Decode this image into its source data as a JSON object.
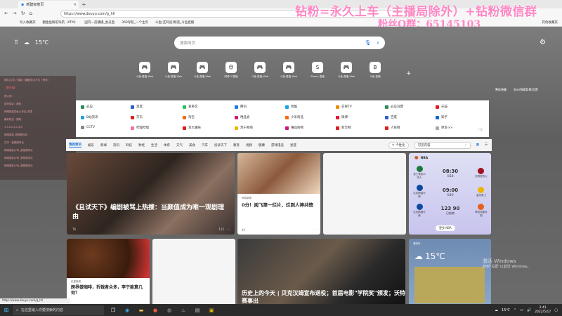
{
  "browser": {
    "tab_title": "新建标签页",
    "url": "https://www.douyu.com/g_hll",
    "favorites": [
      "导入收藏夹",
      "翻金鱼解说导航（ATM）",
      "国内一首播播_会员直",
      "360导航_一个主页",
      "斗鱼(瓦阿迪)频道_斗鱼直播"
    ],
    "favorites_right": "其他收藏夹",
    "status_url": "https://www.douyu.com/g_hll"
  },
  "overlay": {
    "line1": "钻粉=永久上车（主播局除外）+钻粉微信群",
    "line2": "粉丝Q群：65145103"
  },
  "newtab": {
    "weather_temp": "15℃",
    "search_placeholder": "搜索网页",
    "tiles": [
      {
        "label": "斗鱼-直播-Web",
        "icon": "🎮"
      },
      {
        "label": "斗鱼-直播-Web",
        "icon": "🎮"
      },
      {
        "label": "斗鱼-直播-Web",
        "icon": "🎮"
      },
      {
        "label": "网易CC直播",
        "icon": "😊"
      },
      {
        "label": "斗鱼-直播-Web",
        "icon": "🎮"
      },
      {
        "label": "斗鱼-直播-Web",
        "icon": "🎮"
      },
      {
        "label": "Steam 直播",
        "icon": "S"
      },
      {
        "label": "斗鱼-直播-Web",
        "icon": "🎮"
      },
      {
        "label": "斗鱼-直播",
        "icon": "B"
      }
    ],
    "tools": [
      "整体隐藏",
      "显示/隐藏背景/设置"
    ]
  },
  "left_panel": [
    "图片/文字 / 链接 : 隐藏/显示方式（登录）",
    "【新订阅】",
    "黑人帅 : ",
    "成分复杂 : 颜色",
    "网络朋友的女士评论_转发",
    "最好粉丝 : 随机",
    "1.3.4-2.4.2 4/0",
    "网络朋友_音视频评论",
    "文字 : 音视频评论",
    "网络朋友(V8)_音视频评论",
    "网络朋友(V8)_音视频评论",
    "网络朋友(V8)_音视频评论"
  ],
  "quick_links": [
    [
      "必应",
      "百度",
      "爱奇艺",
      "腾讯",
      "优酷",
      "芒果TV",
      "必应词典",
      "天猫"
    ],
    [
      "B站资讯",
      "京东",
      "淘宝",
      "唯品会",
      "小米商品",
      "微博",
      "百度",
      "知乎"
    ],
    [
      "CCTV",
      "哔哩哔哩",
      "双大趣味",
      "苏宁易购",
      "唯品购物",
      "新华网",
      "人民网",
      "更多>>"
    ]
  ],
  "quick_ad": "广告",
  "feed_nav": {
    "items": [
      "我的资讯",
      "娱乐",
      "新闻",
      "资讯",
      "科技",
      "财经",
      "生活",
      "体育",
      "天气",
      "美食",
      "汽车",
      "投诉天下",
      "教育",
      "视频",
      "健康",
      "游戏电竞",
      "星座"
    ],
    "personalize": "个性化",
    "content_select": "可见内容"
  },
  "cards": {
    "main_title": "《且试天下》编剧被骂上热搜：当颜值成为唯一观剧理由",
    "main_source": "T6",
    "main_count": "115",
    "small_source": "网易新闻",
    "small_title": "0分！阅飞第一烂片，烂到人神共愤",
    "small_count": "45",
    "coffee_source": "红星新闻",
    "coffee_title": "跨界做咖啡，折戟者众多，李宁能算几何？",
    "beckham_title": "历史上的今天 | 贝克汉姆宣布退役；首届电影\"学院奖\"颁发；沃特赛事出",
    "weather_label": "漯河市",
    "weather_temp": "15℃"
  },
  "sports": {
    "title": "NBA",
    "games": [
      {
        "home": "波士顿凯尔特人",
        "away": "迈阿密热火",
        "score": "08:30",
        "date": "5/18"
      },
      {
        "home": "达拉斯独行侠",
        "away": "金州勇士",
        "score": "09:00",
        "date": "5/19"
      },
      {
        "home": "达拉斯独行侠",
        "away": "菲尼克斯太阳",
        "score": "123  90",
        "date": "已结束"
      }
    ],
    "more": "更多 NBA"
  },
  "watermark": {
    "line1": "激活 Windows",
    "line2": "转到\"设置\"以激活 Windows。"
  },
  "taskbar": {
    "search_placeholder": "在这里输入你要搜索的内容",
    "temp": "15℃",
    "time": "2:41",
    "date": "2022/5/17"
  }
}
